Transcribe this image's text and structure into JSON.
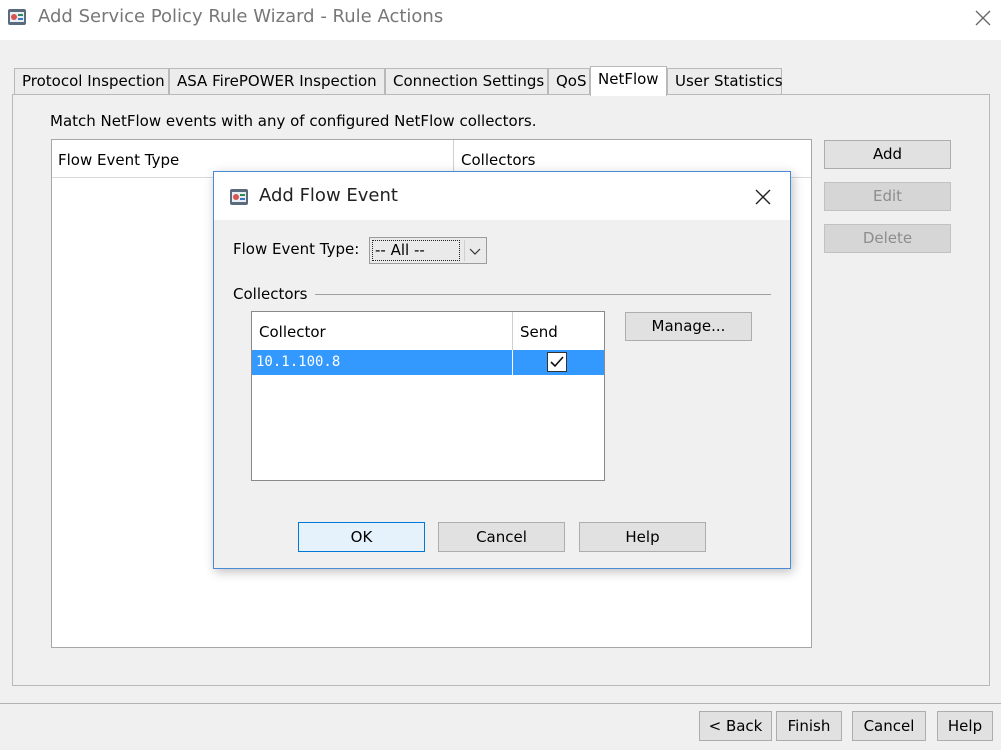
{
  "window": {
    "title": "Add Service Policy Rule Wizard - Rule Actions"
  },
  "tabs": [
    {
      "label": "Protocol Inspection",
      "active": false
    },
    {
      "label": "ASA FirePOWER Inspection",
      "active": false
    },
    {
      "label": "Connection Settings",
      "active": false
    },
    {
      "label": "QoS",
      "active": false
    },
    {
      "label": "NetFlow",
      "active": true
    },
    {
      "label": "User Statistics",
      "active": false
    }
  ],
  "netflow": {
    "description": "Match NetFlow events with any of configured NetFlow collectors.",
    "columns": [
      "Flow Event Type",
      "Collectors"
    ],
    "buttons": {
      "add": "Add",
      "edit": "Edit",
      "delete": "Delete"
    }
  },
  "footer": {
    "back": "< Back",
    "finish": "Finish",
    "cancel": "Cancel",
    "help": "Help"
  },
  "dialog": {
    "title": "Add Flow Event",
    "flow_event_type_label": "Flow Event Type:",
    "flow_event_type_value": "-- All --",
    "collectors_group": "Collectors",
    "columns": [
      "Collector",
      "Send"
    ],
    "rows": [
      {
        "collector": "10.1.100.8",
        "send": true
      }
    ],
    "manage": "Manage...",
    "ok": "OK",
    "cancel": "Cancel",
    "help": "Help"
  },
  "colors": {
    "selection": "#3399ff",
    "dialog_border": "#4a8ad4",
    "default_button_border": "#0078d7"
  }
}
